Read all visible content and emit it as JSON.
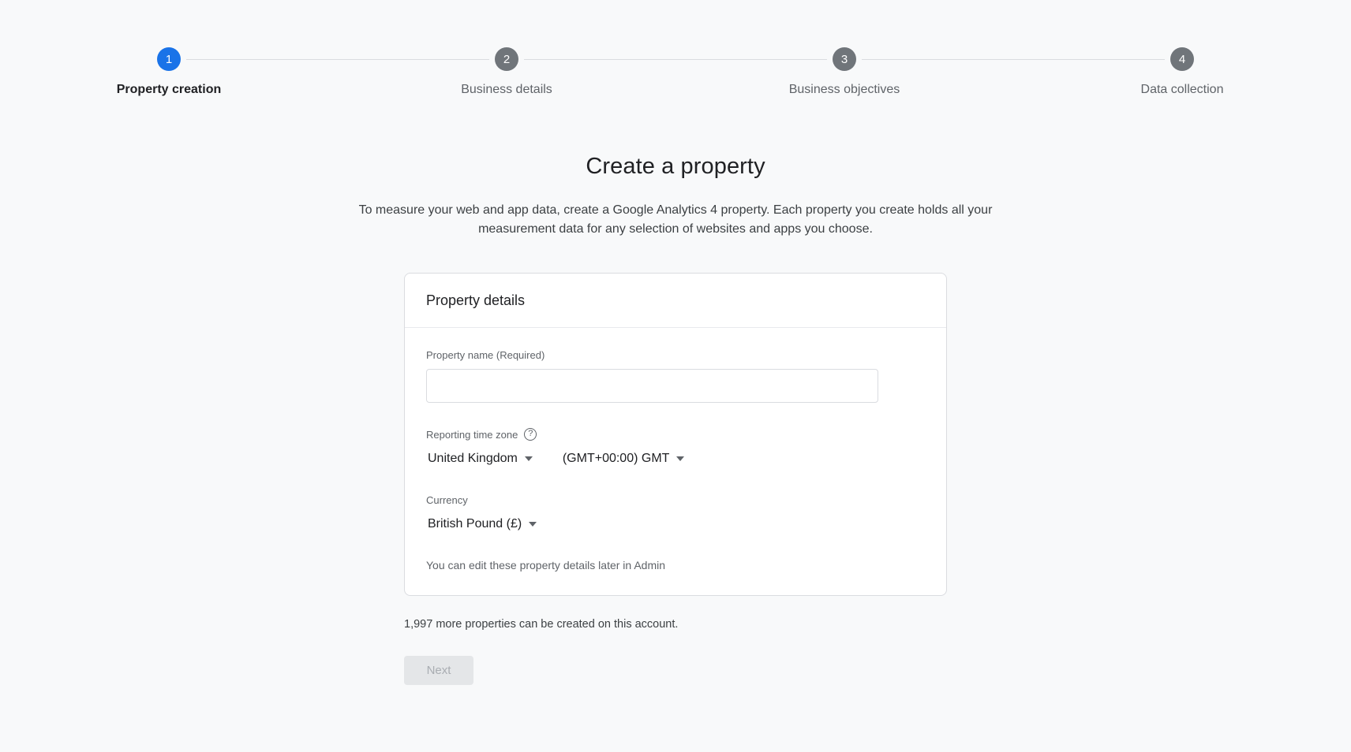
{
  "stepper": {
    "steps": [
      {
        "number": "1",
        "label": "Property creation",
        "state": "active"
      },
      {
        "number": "2",
        "label": "Business details",
        "state": "inactive"
      },
      {
        "number": "3",
        "label": "Business objectives",
        "state": "inactive"
      },
      {
        "number": "4",
        "label": "Data collection",
        "state": "inactive"
      }
    ],
    "active_color": "#1a73e8",
    "inactive_color": "#70757a"
  },
  "main": {
    "title": "Create a property",
    "description": "To measure your web and app data, create a Google Analytics 4 property. Each property you create holds all your measurement data for any selection of websites and apps you choose."
  },
  "card": {
    "header": "Property details",
    "property_name": {
      "label": "Property name (Required)",
      "value": "",
      "placeholder": ""
    },
    "time_zone": {
      "label": "Reporting time zone",
      "help_icon": "help-circle-icon",
      "country_value": "United Kingdom",
      "offset_value": "(GMT+00:00) GMT"
    },
    "currency": {
      "label": "Currency",
      "value": "British Pound (£)"
    },
    "edit_hint": "You can edit these property details later in Admin"
  },
  "footer": {
    "quota_text": "1,997 more properties can be created on this account.",
    "next_label": "Next"
  }
}
